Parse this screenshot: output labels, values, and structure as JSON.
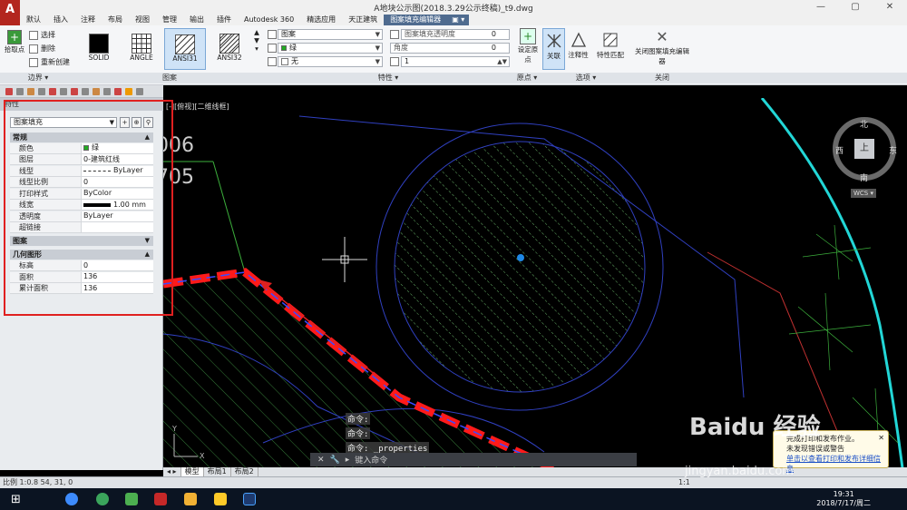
{
  "app": {
    "logo": "A",
    "title": "A地块公示图(2018.3.29公示终稿)_t9.dwg"
  },
  "window_buttons": [
    "—",
    "▢",
    "✕"
  ],
  "tabs": [
    "默认",
    "插入",
    "注释",
    "布局",
    "视图",
    "管理",
    "输出",
    "插件",
    "Autodesk 360",
    "精选应用",
    "天正建筑",
    "图案填充编辑器",
    "▣ ▾"
  ],
  "ribbon": {
    "boundary": {
      "pick_points": "拾取点",
      "select": "选择",
      "remove": "删除",
      "recreate": "重新创建",
      "panel_label": "边界 ▾"
    },
    "patterns": {
      "items": [
        "SOLID",
        "ANGLE",
        "ANSI31",
        "ANSI32"
      ],
      "panel_label": "图案"
    },
    "properties": {
      "type": "图案",
      "color": "绿",
      "background": "无",
      "transparency_label": "图案填充透明度",
      "transparency_value": "0",
      "angle_label": "角度",
      "angle_value": "0",
      "scale_value": "1",
      "panel_label": "特性 ▾"
    },
    "origin": {
      "set_origin": "设定原点",
      "panel_label": "原点 ▾"
    },
    "options": {
      "associative": "关联",
      "annotative": "注释性",
      "match": "特性匹配",
      "panel_label": "选项 ▾"
    },
    "close": {
      "label": "关闭图案填充编辑器",
      "panel_label": "关闭"
    }
  },
  "palette": {
    "title": "特性",
    "selector": "图案填充",
    "sections": {
      "general": "常规",
      "pattern": "图案",
      "geometry": "几何图形"
    },
    "general_rows": [
      {
        "k": "颜色",
        "v": "绿"
      },
      {
        "k": "图层",
        "v": "0-建筑红线"
      },
      {
        "k": "线型",
        "v": "ByLayer"
      },
      {
        "k": "线型比例",
        "v": "0"
      },
      {
        "k": "打印样式",
        "v": "ByColor"
      },
      {
        "k": "线宽",
        "v": "1.00 mm"
      },
      {
        "k": "透明度",
        "v": "ByLayer"
      },
      {
        "k": "超链接",
        "v": ""
      }
    ],
    "geometry_rows": [
      {
        "k": "标高",
        "v": "0"
      },
      {
        "k": "面积",
        "v": "136"
      },
      {
        "k": "累计面积",
        "v": "136"
      }
    ]
  },
  "canvas": {
    "viewport_label": "[-][俯视][二维线框]",
    "numbers": [
      "006",
      "705"
    ],
    "compass": {
      "n": "北",
      "s": "南",
      "w": "西",
      "e": "东",
      "top": "上",
      "wcs": "WCS ▾"
    },
    "ucs_y": "Y",
    "ucs_x": "X"
  },
  "command": {
    "history": [
      "命令:",
      "命令:",
      "命令: _properties"
    ],
    "prompt": "键入命令"
  },
  "layout_tabs": [
    "模型",
    "布局1",
    "布局2"
  ],
  "statusbar": {
    "left": "比例 1:0.8    54, 31, 0",
    "right": "1:1"
  },
  "notification": {
    "title": "完成打印和发布作业。",
    "line2": "未发现错误或警告",
    "link": "单击以查看打印和发布详细信息"
  },
  "clock": {
    "time": "19:31",
    "date": "2018/7/17/周二"
  },
  "watermark": {
    "brand": "Baidu 经验",
    "url": "jingyan.baidu.com"
  }
}
